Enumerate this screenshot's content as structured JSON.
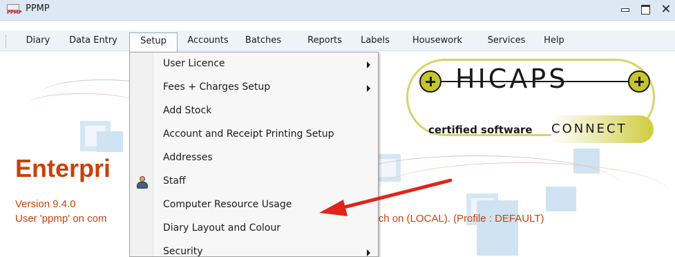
{
  "window": {
    "title": "PPMP",
    "app_icon_text": "PPMP"
  },
  "menubar": {
    "items": [
      {
        "label": "Diary"
      },
      {
        "label": "Data Entry"
      },
      {
        "label": "Setup",
        "active": true
      },
      {
        "label": "Accounts"
      },
      {
        "label": "Batches"
      },
      {
        "label": "Reports"
      },
      {
        "label": "Labels"
      },
      {
        "label": "Housework"
      },
      {
        "label": "Services"
      },
      {
        "label": "Help"
      }
    ]
  },
  "setup_menu": {
    "items": [
      {
        "label": "User Licence",
        "submenu": true
      },
      {
        "label": "Fees + Charges Setup",
        "submenu": true
      },
      {
        "label": "Add Stock"
      },
      {
        "label": "Account and Receipt Printing Setup"
      },
      {
        "label": "Addresses"
      },
      {
        "label": "Staff",
        "icon": "staff-icon"
      },
      {
        "label": "Computer Resource Usage",
        "highlighted_by_arrow": true
      },
      {
        "label": "Diary Layout and Colour"
      },
      {
        "label": "Security",
        "submenu": true
      }
    ]
  },
  "background": {
    "product_name": "Enterpri",
    "version": "Version 9.4.0",
    "user_line_left": "User 'ppmp' on com",
    "user_line_right": "Beach on (LOCAL). (Profile : DEFAULT)"
  },
  "logo": {
    "brand": "HICAPS",
    "certified": "certified software",
    "connect": "CONNECT"
  },
  "annotation": {
    "arrow_color": "#e2231a",
    "target": "Computer Resource Usage"
  },
  "colors": {
    "accent_text": "#c8410a",
    "logo_yellow": "#c5c52c",
    "titlebar": "#dde8f5",
    "menubar": "#eef3fa"
  }
}
